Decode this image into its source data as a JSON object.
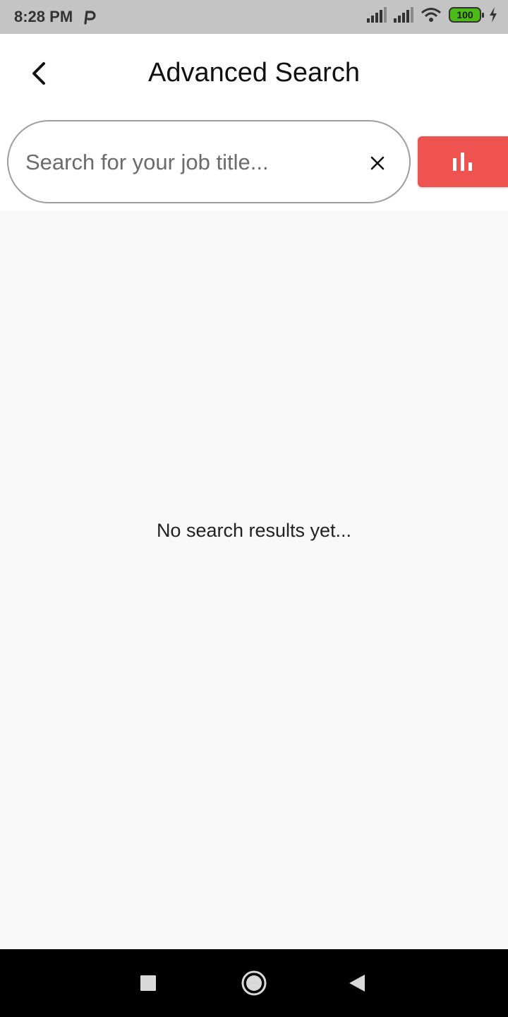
{
  "status_bar": {
    "time": "8:28 PM",
    "battery": "100",
    "icons": [
      "parking-icon",
      "signal-icon",
      "signal-icon",
      "wifi-icon",
      "battery-icon",
      "charging-icon"
    ]
  },
  "header": {
    "title": "Advanced Search",
    "back_icon": "chevron-left-icon"
  },
  "search": {
    "placeholder": "Search for your job title...",
    "value": "",
    "clear_icon": "close-icon",
    "filter_icon": "bar-chart-icon"
  },
  "results": {
    "empty_message": "No search results yet..."
  },
  "nav": {
    "icons": [
      "recents-square-icon",
      "home-circle-icon",
      "back-triangle-icon"
    ]
  },
  "colors": {
    "accent": "#ef5350",
    "status_bar": "#c4c4c4",
    "results_bg": "#f8f8f8",
    "nav_bar": "#000000",
    "battery": "#4cbb17"
  }
}
